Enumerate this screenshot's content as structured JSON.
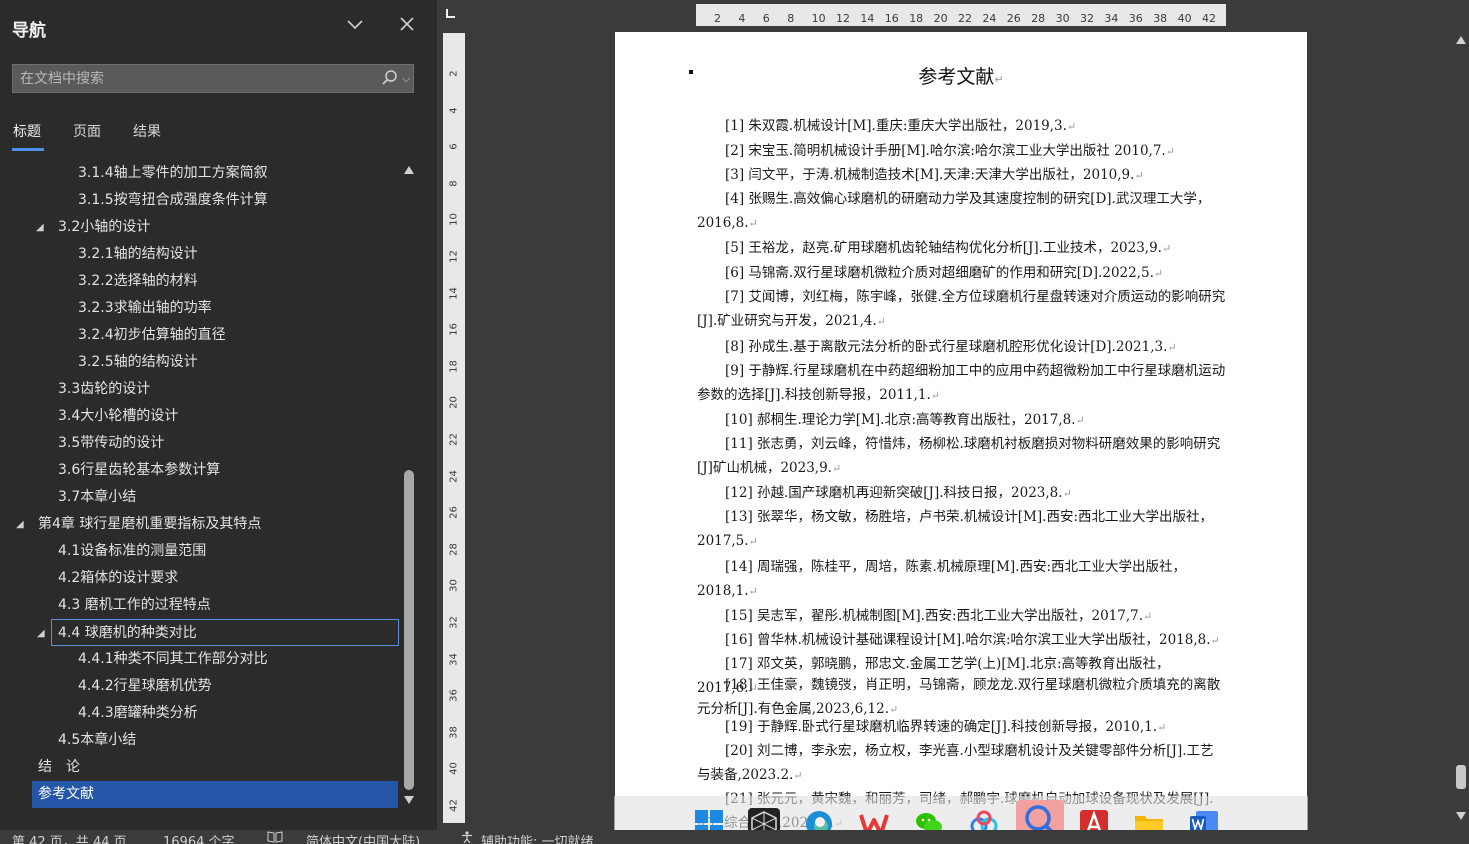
{
  "nav": {
    "title": "导航",
    "search_placeholder": "在文档中搜索",
    "tabs": [
      "标题",
      "页面",
      "结果"
    ],
    "tree": [
      {
        "label": "3.1.4轴上零件的加工方案简叙",
        "level": 3
      },
      {
        "label": "3.1.5按弯扭合成强度条件计算",
        "level": 3
      },
      {
        "label": "3.2小轴的设计",
        "level": 2,
        "expanded": true
      },
      {
        "label": "3.2.1轴的结构设计",
        "level": 3
      },
      {
        "label": "3.2.2选择轴的材料",
        "level": 3
      },
      {
        "label": "3.2.3求输出轴的功率",
        "level": 3
      },
      {
        "label": "3.2.4初步估算轴的直径",
        "level": 3
      },
      {
        "label": "3.2.5轴的结构设计",
        "level": 3
      },
      {
        "label": "3.3齿轮的设计",
        "level": 2
      },
      {
        "label": "3.4大小轮槽的设计",
        "level": 2
      },
      {
        "label": "3.5带传动的设计",
        "level": 2
      },
      {
        "label": "3.6行星齿轮基本参数计算",
        "level": 2
      },
      {
        "label": "3.7本章小结",
        "level": 2
      },
      {
        "label": "第4章 球行星磨机重要指标及其特点",
        "level": 1,
        "expanded": true
      },
      {
        "label": "4.1设备标准的测量范围",
        "level": 2
      },
      {
        "label": "4.2箱体的设计要求",
        "level": 2
      },
      {
        "label": "4.3 磨机工作的过程特点",
        "level": 2
      },
      {
        "label": "4.4 球磨机的种类对比",
        "level": 2,
        "expanded": true,
        "state": "outlined"
      },
      {
        "label": "4.4.1种类不同其工作部分对比",
        "level": 3
      },
      {
        "label": "4.4.2行星球磨机优势",
        "level": 3
      },
      {
        "label": "4.4.3磨罐种类分析",
        "level": 3
      },
      {
        "label": "4.5本章小结",
        "level": 2
      },
      {
        "label": "结　论",
        "level": 1
      },
      {
        "label": "参考文献",
        "level": 1,
        "state": "selected"
      }
    ]
  },
  "ruler": {
    "h_ticks": [
      "2",
      "4",
      "6",
      "8",
      "10",
      "12",
      "14",
      "16",
      "18",
      "20",
      "22",
      "24",
      "26",
      "28",
      "30",
      "32",
      "34",
      "36",
      "38",
      "40",
      "42"
    ],
    "v_ticks": [
      "2",
      "4",
      "6",
      "8",
      "10",
      "12",
      "14",
      "16",
      "18",
      "20",
      "22",
      "24",
      "26",
      "28",
      "30",
      "32",
      "34",
      "36",
      "38",
      "40",
      "42"
    ]
  },
  "document": {
    "heading": "参考文献",
    "references": [
      "[1] 朱双霞.机械设计[M].重庆:重庆大学出版社，2019,3.",
      "[2] 宋宝玉.简明机械设计手册[M].哈尔滨:哈尔滨工业大学出版社 2010,7.",
      "[3] 闫文平，于涛.机械制造技术[M].天津:天津大学出版社，2010,9.",
      "[4] 张赐生.高效偏心球磨机的研磨动力学及其速度控制的研究[D].武汉理工大学，2016,8.",
      "[5] 王裕龙，赵亮.矿用球磨机齿轮轴结构优化分析[J].工业技术，2023,9.",
      "[6] 马锦斋.双行星球磨机微粒介质对超细磨矿的作用和研究[D].2022,5.",
      "[7] 艾闻博，刘红梅，陈宇峰，张健.全方位球磨机行星盘转速对介质运动的影响研究[J].矿业研究与开发，2021,4.",
      "[8] 孙成生.基于离散元法分析的卧式行星球磨机腔形优化设计[D].2021,3.",
      "[9] 于静辉.行星球磨机在中药超细粉加工中的应用中药超微粉加工中行星球磨机运动参数的选择[J].科技创新导报，2011,1.",
      "[10] 郝桐生.理论力学[M].北京:高等教育出版社，2017,8.",
      "[11] 张志勇，刘云峰，符惜炜，杨柳松.球磨机衬板磨损对物料研磨效果的影响研究[J]矿山机械，2023,9.",
      "[12] 孙越.国产球磨机再迎新突破[J].科技日报，2023,8.",
      "[13] 张翠华，杨文敏，杨胜培，卢书荣.机械设计[M].西安:西北工业大学出版社，2017,5.",
      "[14] 周瑞强，陈桂平，周培，陈素.机械原理[M].西安:西北工业大学出版社，2018,1.",
      "[15] 吴志军，翟彤.机械制图[M].西安:西北工业大学出版社，2017,7.",
      "[16] 曾华林.机械设计基础课程设计[M].哈尔滨:哈尔滨工业大学出版社，2018,8.",
      "[17] 邓文英，郭晓鹏，邢忠文.金属工艺学(上)[M].北京:高等教育出版社，2017,6.",
      "[18] 王佳豪，魏镜弢，肖正明，马锦斋，顾龙龙.双行星球磨机微粒介质填充的离散元分析[J].有色金属,2023,6,12.",
      "[19] 于静辉.卧式行星球磨机临界转速的确定[J].科技创新导报，2010,1.",
      "[20] 刘二博，李永宏，杨立权，李光喜.小型球磨机设计及关键零部件分析[J].工艺与装备,2023.2.",
      "[21] 张元元，黄宋魏，和丽芳，司绪，郝鹏宇.球磨机自动加球设备现状及发展[J].矿产综合利用,2022,1."
    ]
  },
  "statusbar": {
    "page": "第 42 页，共 44 页",
    "words": "16964 个字",
    "language": "简体中文(中国大陆)",
    "accessibility": "辅助功能: 一切就绪"
  },
  "taskbar": {
    "apps": [
      "windows-start",
      "app-launcher",
      "edge",
      "wps",
      "wechat",
      "baidu-netdisk",
      "search-assistant",
      "acrobat",
      "file-explorer",
      "word"
    ]
  },
  "colors": {
    "accent": "#4c8ee8",
    "selected": "#2457a8",
    "pane_bg": "#2b2b2b",
    "canvas_bg": "#3b3b3b"
  }
}
